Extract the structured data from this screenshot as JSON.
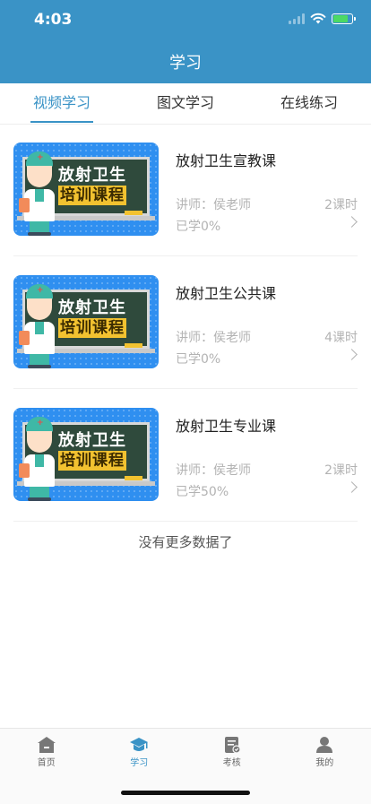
{
  "status_bar": {
    "time": "4:03"
  },
  "header": {
    "title": "学习"
  },
  "tabs": [
    {
      "label": "视频学习",
      "active": true
    },
    {
      "label": "图文学习",
      "active": false
    },
    {
      "label": "在线练习",
      "active": false
    }
  ],
  "thumbnail": {
    "line1": "放射卫生",
    "line2": "培训课程"
  },
  "courses": [
    {
      "title": "放射卫生宣教课",
      "teacher": "讲师：侯老师",
      "hours": "2课时",
      "progress": "已学0%"
    },
    {
      "title": "放射卫生公共课",
      "teacher": "讲师：侯老师",
      "hours": "4课时",
      "progress": "已学0%"
    },
    {
      "title": "放射卫生专业课",
      "teacher": "讲师：侯老师",
      "hours": "2课时",
      "progress": "已学50%"
    }
  ],
  "list_footer": "没有更多数据了",
  "tabbar": [
    {
      "label": "首页",
      "icon": "home-icon",
      "active": false
    },
    {
      "label": "学习",
      "icon": "graduation-cap-icon",
      "active": true
    },
    {
      "label": "考核",
      "icon": "exam-icon",
      "active": false
    },
    {
      "label": "我的",
      "icon": "user-icon",
      "active": false
    }
  ],
  "colors": {
    "primary": "#3a93c6",
    "thumb_bg": "#2f8ff0",
    "chalkboard": "#2f4a3c",
    "highlight": "#f2c230"
  }
}
